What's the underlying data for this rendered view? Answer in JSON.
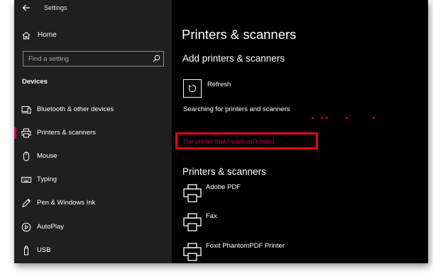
{
  "app": {
    "title": "Settings"
  },
  "sidebar": {
    "home_label": "Home",
    "search_placeholder": "Find a setting",
    "section_title": "Devices",
    "items": [
      {
        "label": "Bluetooth & other devices",
        "icon": "bluetooth-devices-icon",
        "selected": false
      },
      {
        "label": "Printers & scanners",
        "icon": "printer-icon",
        "selected": true
      },
      {
        "label": "Mouse",
        "icon": "mouse-icon",
        "selected": false
      },
      {
        "label": "Typing",
        "icon": "keyboard-icon",
        "selected": false
      },
      {
        "label": "Pen & Windows Ink",
        "icon": "pen-icon",
        "selected": false
      },
      {
        "label": "AutoPlay",
        "icon": "autoplay-icon",
        "selected": false
      },
      {
        "label": "USB",
        "icon": "usb-icon",
        "selected": false
      }
    ]
  },
  "main": {
    "page_title": "Printers & scanners",
    "add_section_title": "Add printers & scanners",
    "refresh_label": "Refresh",
    "searching_text": "Searching for printers and scanners",
    "not_listed_link": "The printer that I want isn't listed",
    "printers_section_title": "Printers & scanners",
    "printers": [
      {
        "name": "Adobe PDF"
      },
      {
        "name": "Fax"
      },
      {
        "name": "Foxit PhantomPDF Printer"
      }
    ]
  },
  "colors": {
    "accent": "#c30052",
    "highlight": "#e30613",
    "sidebar_bg": "#1f1f1f",
    "main_bg": "#000000"
  }
}
